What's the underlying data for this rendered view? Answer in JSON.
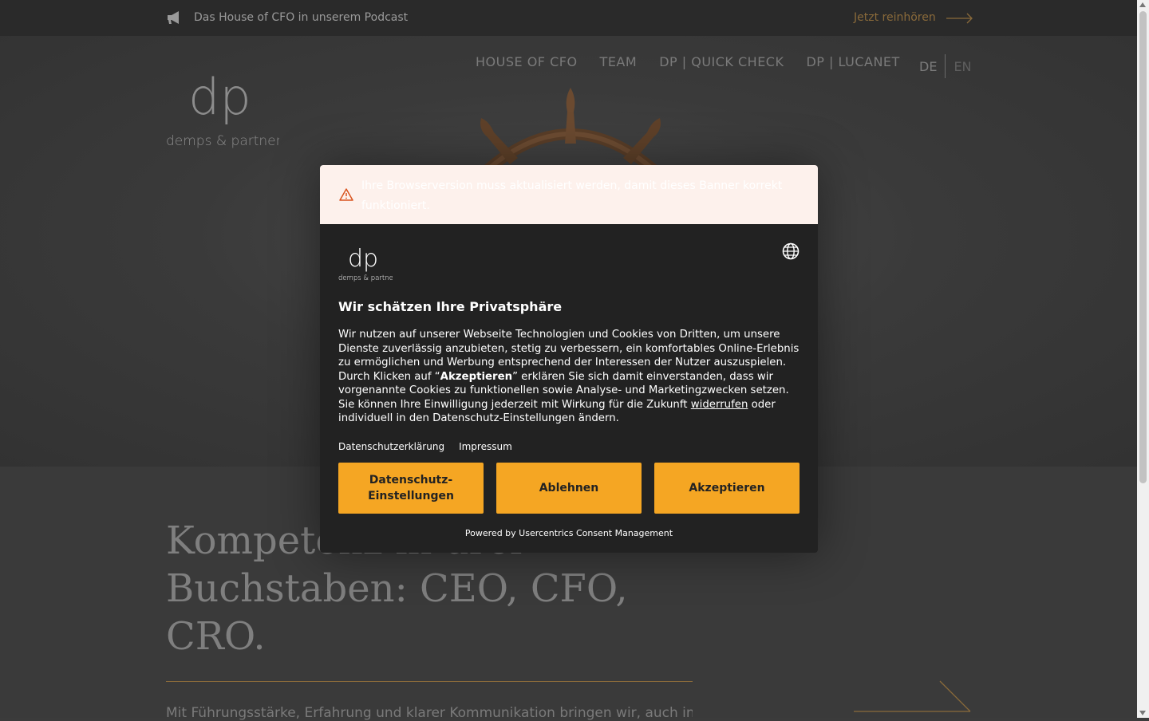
{
  "topbar": {
    "podcast_text": "Das House of CFO in unserem Podcast",
    "listen_link": "Jetzt reinhören"
  },
  "logo": {
    "monogram": "dp",
    "wordmark": "demps & partner"
  },
  "nav": {
    "items": [
      {
        "label": "HOUSE OF CFO"
      },
      {
        "label": "TEAM"
      },
      {
        "label": "DP | QUICK CHECK"
      },
      {
        "label": "DP | LUCANET"
      }
    ],
    "lang_de": "DE",
    "lang_en": "EN"
  },
  "hero": {
    "headline": "Kompetenz in drei Buchstaben: CEO, CFO, CRO.",
    "subtext": "Mit Führungsstärke, Erfahrung und klarer Kommunikation bringen wir, auch in"
  },
  "consent": {
    "warning": "Ihre Browserversion muss aktualisiert werden, damit dieses Banner korrekt funktioniert.",
    "title": "Wir schätzen Ihre Privatsphäre",
    "body_part1": "Wir nutzen auf unserer Webseite Technologien und Cookies von Dritten, um unsere Dienste zuverlässig anzubieten, stetig zu verbessern, ein komfortables Online-Erlebnis zu ermöglichen und Werbung entsprechend der Interessen der Nutzer auszuspielen. Durch Klicken auf “",
    "body_bold": "Akzeptieren",
    "body_part2": "” erklären Sie sich damit einverstanden, dass wir vorgenannte Cookies zu funktionellen sowie Analyse- und Marketingzwecken setzen. Sie können Ihre Einwilligung jederzeit mit Wirkung für die Zukunft ",
    "body_link": "widerrufen",
    "body_part3": " oder individuell in den Datenschutz-Einstellungen ändern.",
    "link_privacy": "Datenschutzerklärung",
    "link_imprint": "Impressum",
    "btn_settings": "Datenschutz-Einstellungen",
    "btn_decline": "Ablehnen",
    "btn_accept": "Akzeptieren",
    "powered": "Powered by Usercentrics Consent Management",
    "logo_monogram": "dp",
    "logo_wordmark": "demps & partner"
  },
  "colors": {
    "accent": "#f5a623",
    "gold": "#8a6a3a",
    "dialog_bg": "#222222",
    "warning_bg": "#fdf1ec"
  }
}
